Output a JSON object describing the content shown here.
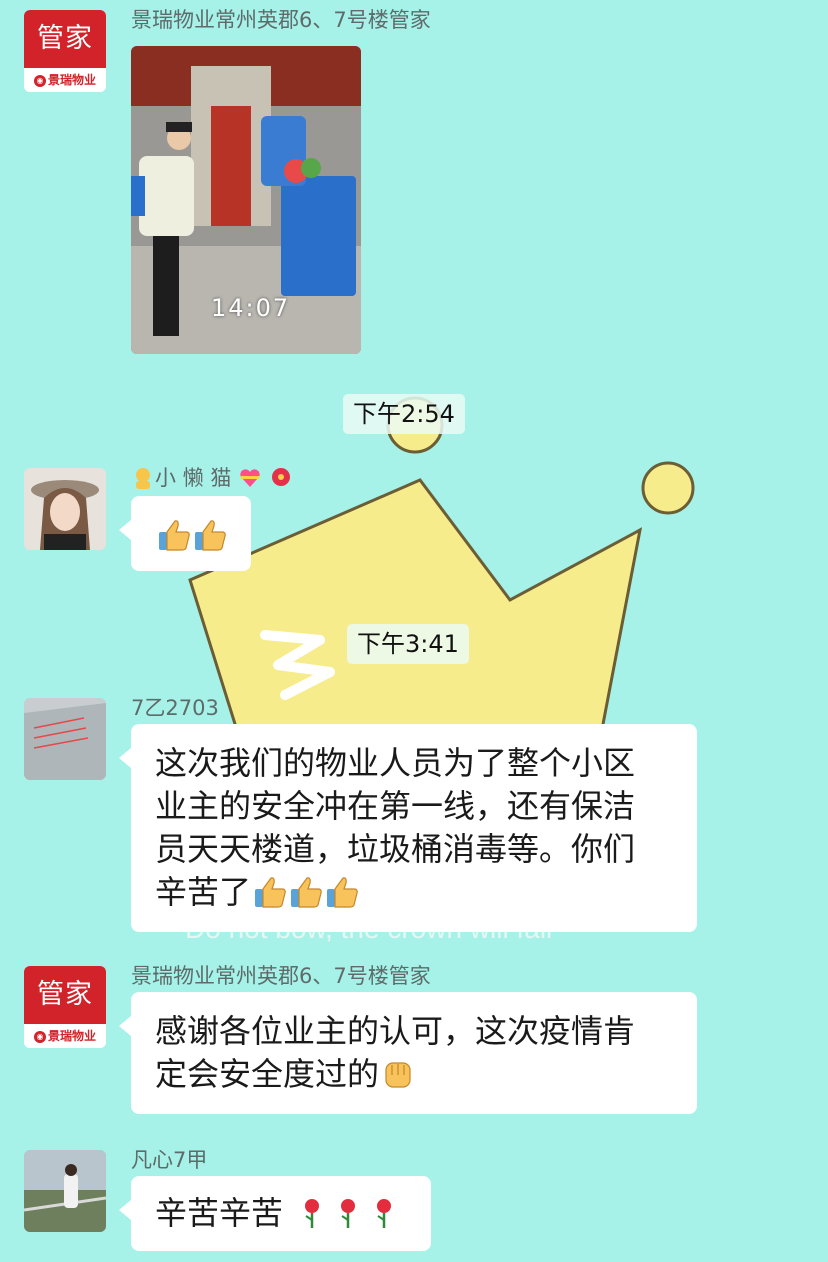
{
  "messages": [
    {
      "sender": "景瑞物业常州英郡6、7号楼管家",
      "video_time": "14:07"
    },
    {
      "sender_name": "小 懒 猫"
    },
    {
      "sender": "7乙2703",
      "text_lines": [
        "这次我们的物业人员为了整个小区",
        "业主的安全冲在第一线，还有保洁",
        "员天天楼道，垃圾桶消毒等。你们",
        "辛苦了"
      ]
    },
    {
      "sender": "景瑞物业常州英郡6、7号楼管家",
      "text_lines": [
        "感谢各位业主的认可，这次疫情肯",
        "定会安全度过的"
      ]
    },
    {
      "sender": "凡心7甲",
      "text": "辛苦辛苦"
    }
  ],
  "brand_avatar": {
    "top": "管家",
    "bottom": "景瑞物业"
  },
  "timestamps": [
    "下午2:54",
    "下午3:41"
  ],
  "colors": {
    "background": "#a6f2e9",
    "brand_red": "#d2232a",
    "crown": "#f7ec8c"
  },
  "icons": [
    "thumbs-up-icon",
    "fist-icon",
    "rose-icon",
    "heart-gift-icon",
    "hibiscus-icon",
    "person-emoji-icon"
  ]
}
